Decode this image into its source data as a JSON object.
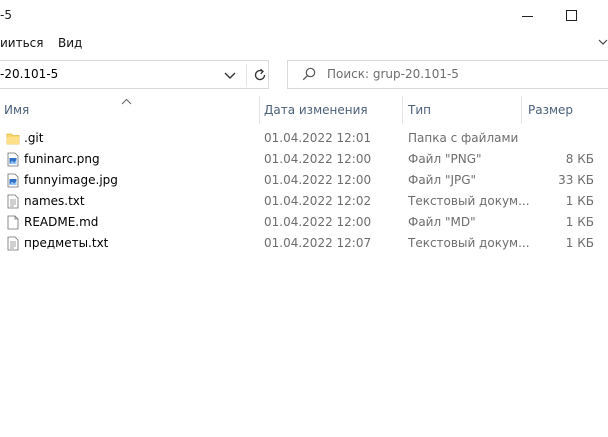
{
  "window": {
    "title": "-5",
    "min_label": "",
    "max_label": ""
  },
  "ribbon": {
    "tabs": [
      {
        "label": "ииться"
      },
      {
        "label": "Вид"
      }
    ]
  },
  "address": {
    "path": "-20.101-5"
  },
  "search": {
    "placeholder": "Поиск: grup-20.101-5"
  },
  "columns": {
    "name": "Имя",
    "date": "Дата изменения",
    "type": "Тип",
    "size": "Размер"
  },
  "files": [
    {
      "name": ".git",
      "date": "01.04.2022 12:01",
      "type": "Папка с файлами",
      "size": "",
      "icon": "folder-icon"
    },
    {
      "name": "funinarc.png",
      "date": "01.04.2022 12:00",
      "type": "Файл \"PNG\"",
      "size": "8 КБ",
      "icon": "image-file-icon"
    },
    {
      "name": "funnyimage.jpg",
      "date": "01.04.2022 12:00",
      "type": "Файл \"JPG\"",
      "size": "33 КБ",
      "icon": "image-file-icon"
    },
    {
      "name": "names.txt",
      "date": "01.04.2022 12:02",
      "type": "Текстовый докум...",
      "size": "1 КБ",
      "icon": "text-file-icon"
    },
    {
      "name": "README.md",
      "date": "01.04.2022 12:00",
      "type": "Файл \"MD\"",
      "size": "1 КБ",
      "icon": "file-icon"
    },
    {
      "name": "предметы.txt",
      "date": "01.04.2022 12:07",
      "type": "Текстовый докум...",
      "size": "1 КБ",
      "icon": "text-file-icon"
    }
  ]
}
